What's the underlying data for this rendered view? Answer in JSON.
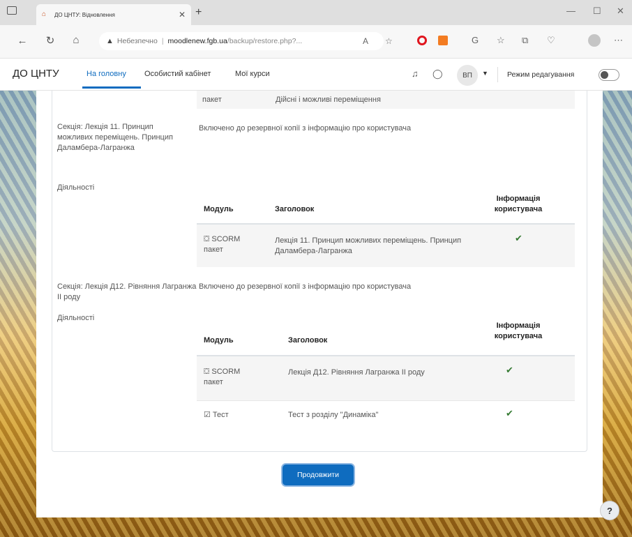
{
  "browser": {
    "tab_title": "ДО ЦНТУ: Відновлення",
    "url_warning": "Небезпечно",
    "url_host": "moodlenew.fgb.ua",
    "url_path": "/backup/restore.php?...",
    "minimize": "—",
    "maximize": "☐",
    "close": "✕"
  },
  "header": {
    "brand": "ДО ЦНТУ",
    "nav": [
      "На головну",
      "Особистий кабінет",
      "Мої курси"
    ],
    "avatar_initials": "ВП",
    "edit_mode_label": "Режим редагування"
  },
  "content": {
    "top_row": {
      "module": "пакет",
      "title": "Дійсні і можливі переміщення"
    },
    "sections": [
      {
        "label": "Секція: Лекція 11. Принцип можливих переміщень. Принцип Даламбера-Лагранжа",
        "status": "Включено до резервної копії з інформацію про користувача",
        "activities_label": "Діяльності",
        "columns": [
          "Модуль",
          "Заголовок",
          "Інформація користувача"
        ],
        "rows": [
          {
            "module": "SCORM пакет",
            "title": "Лекція 11. Принцип можливих переміщень. Принцип Даламбера-Лагранжа",
            "user_info": "✔"
          }
        ]
      },
      {
        "label": "Секція: Лекція Д12. Рівняння Лагранжа II роду",
        "status": "Включено до резервної копії з інформацію про користувача",
        "activities_label": "Діяльності",
        "columns": [
          "Модуль",
          "Заголовок",
          "Інформація користувача"
        ],
        "rows": [
          {
            "module": "SCORM пакет",
            "title": "Лекція Д12. Рівняння Лагранжа II роду",
            "user_info": "✔"
          },
          {
            "module": "Тест",
            "title": "Тест з розділу \"Динаміка\"",
            "user_info": "✔"
          }
        ]
      }
    ],
    "continue_button": "Продовжити",
    "help": "?"
  }
}
